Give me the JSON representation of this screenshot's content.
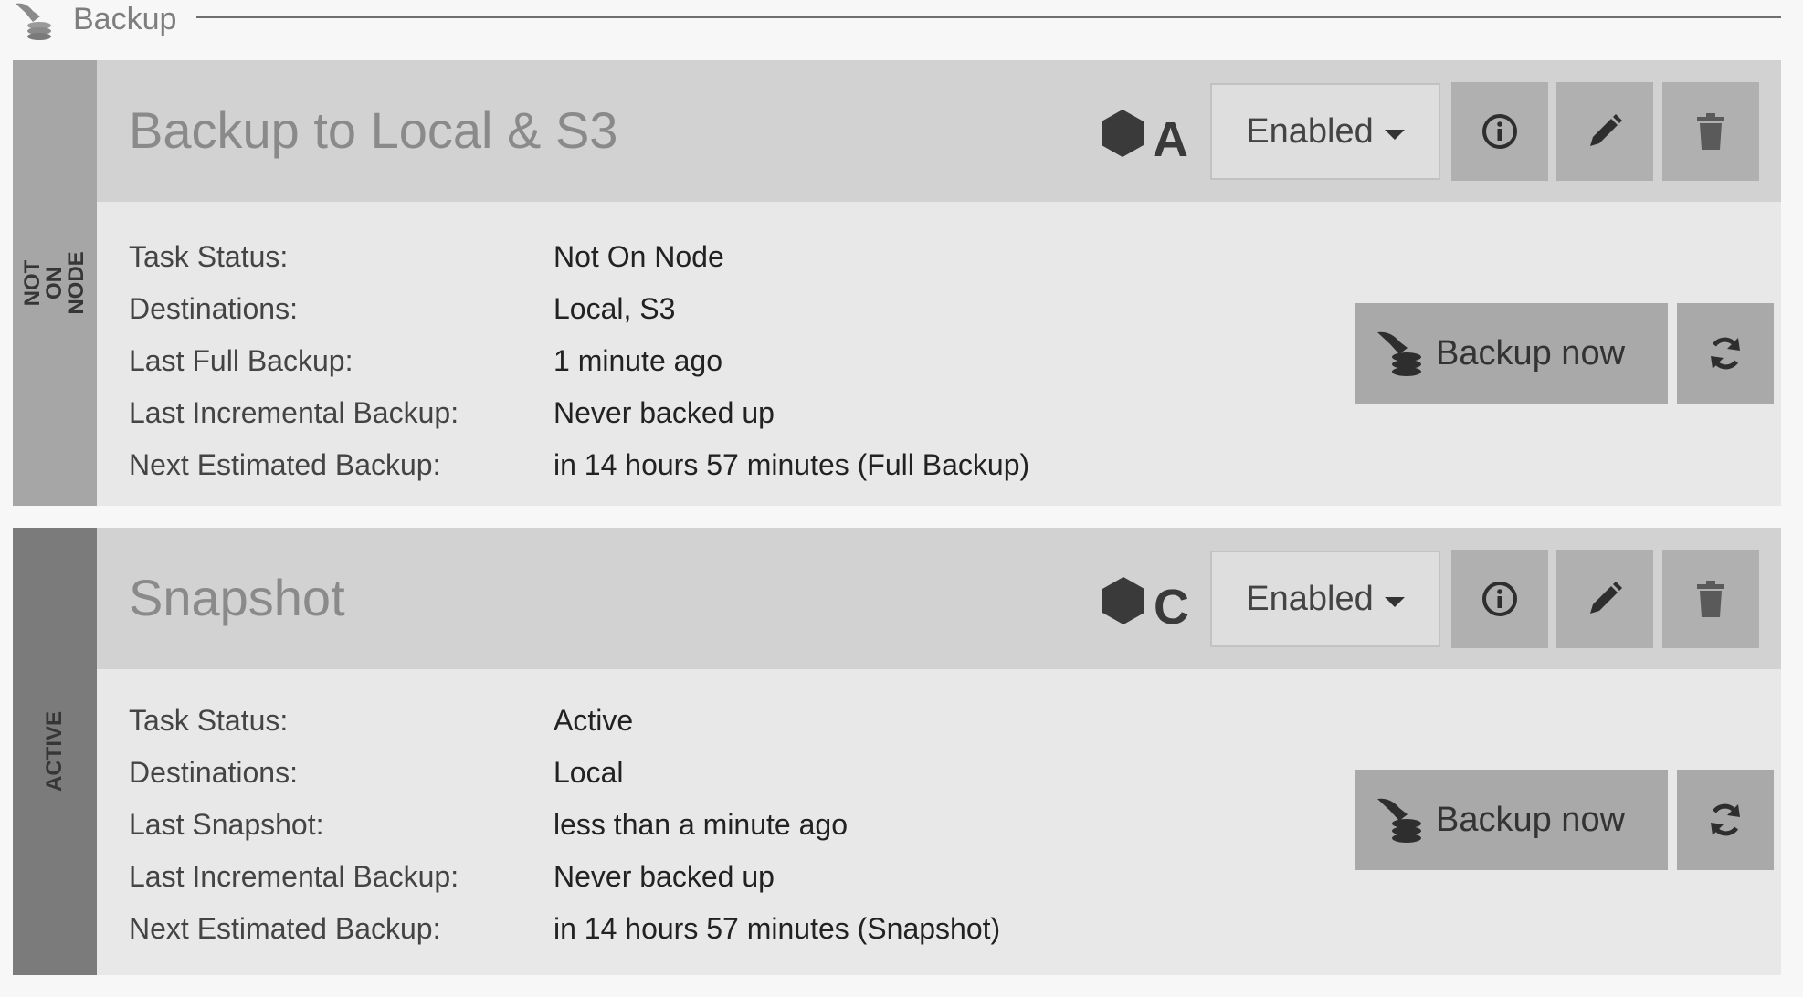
{
  "section": {
    "title": "Backup"
  },
  "tasks": [
    {
      "title": "Backup to Local & S3",
      "state_label": [
        "NOT",
        "ON",
        "NODE"
      ],
      "node_letter": "A",
      "dropdown_value": "Enabled",
      "rows": [
        {
          "label": "Task Status:",
          "value": "Not On Node"
        },
        {
          "label": "Destinations:",
          "value": "Local, S3"
        },
        {
          "label": "Last Full Backup:",
          "value": "1 minute ago"
        },
        {
          "label": "Last Incremental Backup:",
          "value": "Never backed up"
        },
        {
          "label": "Next Estimated Backup:",
          "value": "in 14 hours 57 minutes (Full Backup)"
        }
      ],
      "backup_button": "Backup now"
    },
    {
      "title": "Snapshot",
      "state_label": [
        "ACTIVE"
      ],
      "node_letter": "C",
      "dropdown_value": "Enabled",
      "rows": [
        {
          "label": "Task Status:",
          "value": "Active"
        },
        {
          "label": "Destinations:",
          "value": "Local"
        },
        {
          "label": "Last Snapshot:",
          "value": "less than a minute ago"
        },
        {
          "label": "Last Incremental Backup:",
          "value": "Never backed up"
        },
        {
          "label": "Next Estimated Backup:",
          "value": "in 14 hours 57 minutes (Snapshot)"
        }
      ],
      "backup_button": "Backup now"
    }
  ],
  "icons": {
    "header": "backup-icon",
    "node": "hexagon-icon",
    "info": "info-icon",
    "edit": "pencil-icon",
    "delete": "trash-icon",
    "backup": "backup-icon",
    "refresh": "refresh-icon"
  }
}
